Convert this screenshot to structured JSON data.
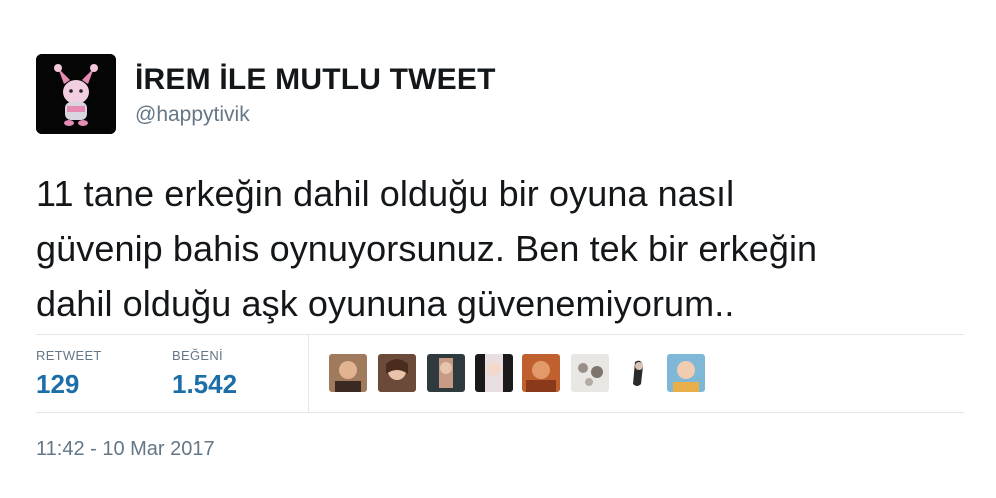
{
  "user": {
    "display_name": "İREM İLE MUTLU TWEET",
    "handle": "@happytivik",
    "avatar_icon": "pink-bunny-avatar"
  },
  "tweet": {
    "text_lines": [
      "11 tane erkeğin dahil olduğu bir oyuna nasıl",
      "güvenip bahis oynuyorsunuz. Ben tek bir erkeğin",
      "dahil olduğu aşk oyununa güvenemiyorum.."
    ]
  },
  "stats": {
    "retweets_label": "RETWEET",
    "retweets_value": "129",
    "likes_label": "BEĞENİ",
    "likes_value": "1.542"
  },
  "timestamp": "11:42 - 10 Mar 2017",
  "colors": {
    "stat_value": "#1b6ea8",
    "secondary_text": "#657786",
    "divider": "#e1e8ed"
  }
}
